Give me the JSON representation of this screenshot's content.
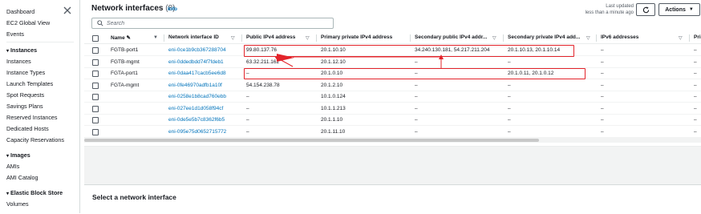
{
  "sidebar": {
    "top_items": [
      "Dashboard",
      "EC2 Global View",
      "Events"
    ],
    "sections": [
      {
        "heading": "Instances",
        "items": [
          "Instances",
          "Instance Types",
          "Launch Templates",
          "Spot Requests",
          "Savings Plans",
          "Reserved Instances",
          "Dedicated Hosts",
          "Capacity Reservations"
        ]
      },
      {
        "heading": "Images",
        "items": [
          "AMIs",
          "AMI Catalog"
        ]
      },
      {
        "heading": "Elastic Block Store",
        "items": [
          "Volumes"
        ]
      }
    ]
  },
  "header": {
    "title": "Network interfaces",
    "count": "(8)",
    "info": "Info",
    "last_updated_line1": "Last updated",
    "last_updated_line2": "less than a minute ago",
    "actions_label": "Actions"
  },
  "search": {
    "placeholder": "Search"
  },
  "table": {
    "columns": [
      "Name",
      "Network interface ID",
      "Public IPv4 address",
      "Primary private IPv4 address",
      "Secondary public IPv4 addr...",
      "Secondary private IPv4 add...",
      "IPv6 addresses",
      "Pri"
    ],
    "rows": [
      [
        "FGTB-port1",
        "eni-0ce1b9cb367288704",
        "99.80.137.76",
        "20.1.10.10",
        "34.240.130.181, 54.217.211.204",
        "20.1.10.13, 20.1.10.14",
        "–",
        "–"
      ],
      [
        "FGTB-mgmt",
        "eni-0ddedbdd74f7fdeb1",
        "63.32.211.162",
        "20.1.12.10",
        "–",
        "–",
        "–",
        "–"
      ],
      [
        "FGTA-port1",
        "eni-0daa417cacb5ee6d8",
        "–",
        "20.1.0.10",
        "–",
        "20.1.0.11, 20.1.0.12",
        "–",
        "–"
      ],
      [
        "FGTA-mgmt",
        "eni-0fe46970adfb1a10f",
        "54.154.238.78",
        "20.1.2.10",
        "–",
        "–",
        "–",
        "–"
      ],
      [
        "",
        "eni-0258e1b8cad760ebb",
        "–",
        "10.1.0.124",
        "–",
        "–",
        "–",
        "–"
      ],
      [
        "",
        "eni-027ee1d1d058f94cf",
        "–",
        "10.1.1.213",
        "–",
        "–",
        "–",
        "–"
      ],
      [
        "",
        "eni-0de5e5b7c8362f6b5",
        "–",
        "20.1.1.10",
        "–",
        "–",
        "–",
        "–"
      ],
      [
        "",
        "eni-095e75d0652715772",
        "–",
        "20.1.11.10",
        "–",
        "–",
        "–",
        "–"
      ]
    ]
  },
  "detail": {
    "title": "Select a network interface"
  },
  "colors": {
    "link": "#0073bb",
    "highlight": "#e3242b",
    "text": "#16191f"
  }
}
